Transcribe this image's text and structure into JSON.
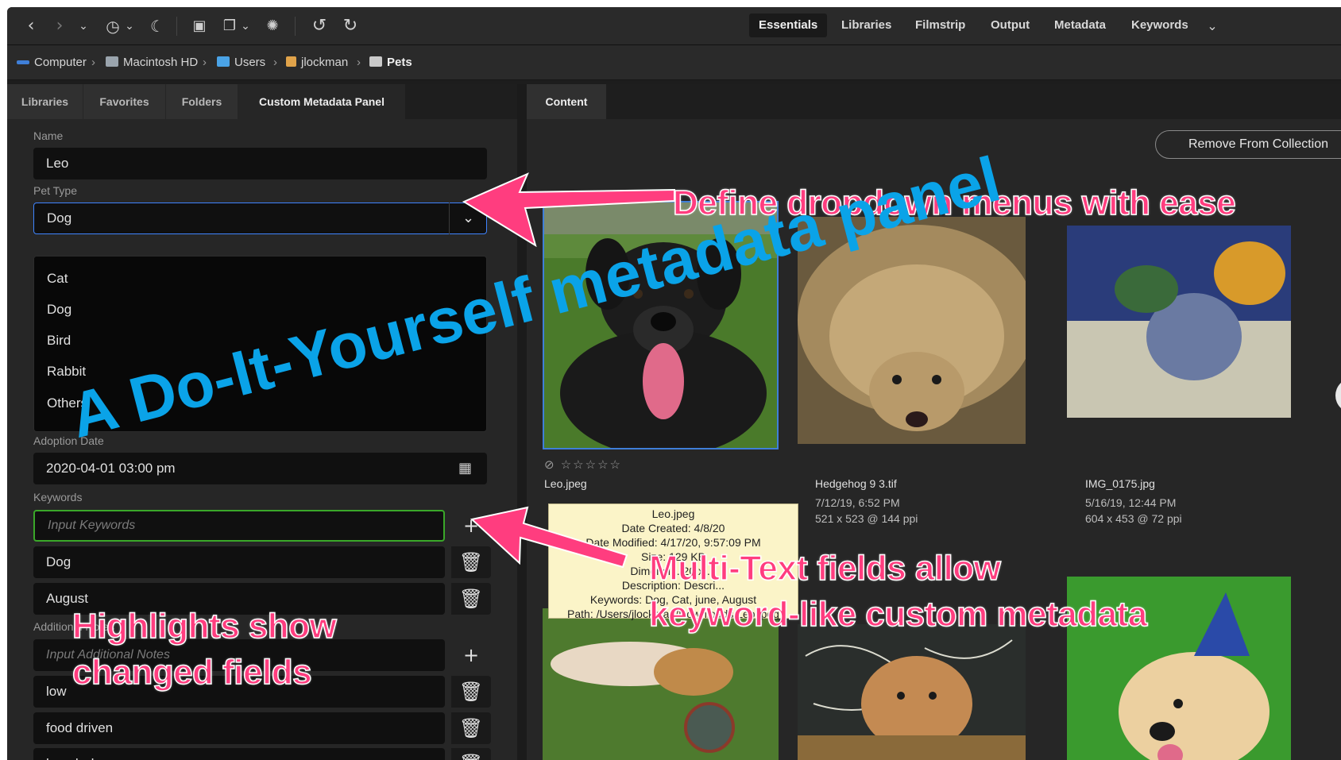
{
  "toolbar": {
    "workspaces": [
      "Essentials",
      "Libraries",
      "Filmstrip",
      "Output",
      "Metadata",
      "Keywords"
    ],
    "active_workspace": "Essentials"
  },
  "breadcrumb": [
    "Computer",
    "Macintosh HD",
    "Users",
    "jlockman",
    "Pets"
  ],
  "left_panel": {
    "tabs": [
      "Libraries",
      "Favorites",
      "Folders",
      "Custom Metadata Panel"
    ],
    "active_tab": "Custom Metadata Panel",
    "name_label": "Name",
    "name_value": "Leo",
    "pet_type_label": "Pet Type",
    "pet_type_value": "Dog",
    "pet_type_options": [
      "Cat",
      "Dog",
      "Bird",
      "Rabbit",
      "Others"
    ],
    "adoption_label": "Adoption Date",
    "adoption_value": "2020-04-01 03:00 pm",
    "keywords_label": "Keywords",
    "keywords_placeholder": "Input Keywords",
    "keywords": [
      "Dog",
      "August"
    ],
    "notes_label": "Additional Notes",
    "notes_placeholder": "Input Additional Notes",
    "notes": [
      "low",
      "food driven",
      "beach dog"
    ]
  },
  "content": {
    "tab": "Content",
    "remove_button": "Remove From Collection",
    "items": [
      {
        "name": "Leo.jpeg",
        "date": "",
        "dims": ""
      },
      {
        "name": "Hedgehog 9 3.tif",
        "date": "7/12/19, 6:52 PM",
        "dims": "521 x 523 @ 144 ppi"
      },
      {
        "name": "IMG_0175.jpg",
        "date": "5/16/19, 12:44 PM",
        "dims": "604 x 453 @ 72 ppi"
      }
    ],
    "tooltip": [
      "Leo.jpeg",
      "Date Created: 4/8/20",
      "Date Modified: 4/17/20, 9:57:09 PM",
      "Size: 129 KB",
      "Dimensi... 20 x ...",
      "Description: Descri...",
      "Keywords: Dog, Cat, june, August",
      "Path: /Users/jlockman/Downloads/Leo.jpeg"
    ]
  },
  "annotations": {
    "title": "A Do-It-Yourself metadata panel",
    "dropdown": "Define dropdown menus with ease",
    "multitext_1": "Multi-Text fields allow",
    "multitext_2": "keyword-like custom metadata",
    "highlights_1": "Highlights show",
    "highlights_2": "changed fields"
  },
  "colors": {
    "annotation_pink": "#ff3d7f",
    "title_blue": "#0aa3e8",
    "changed_field_green": "#3aa829",
    "selection_blue": "#3f84ff",
    "panel_bg": "#262626"
  }
}
